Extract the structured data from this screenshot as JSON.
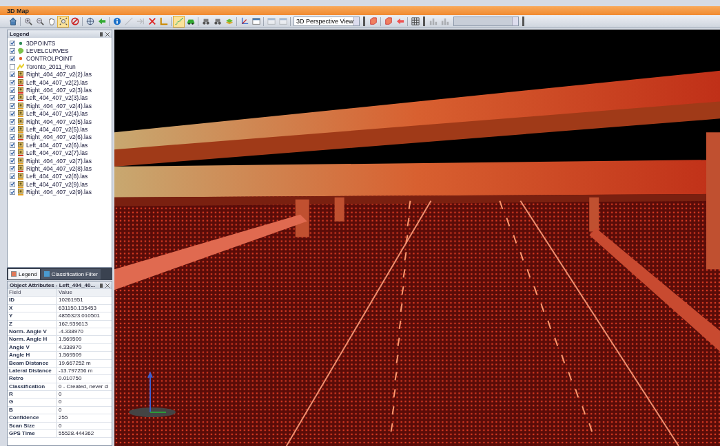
{
  "window": {
    "title": "3D Map"
  },
  "toolbar": {
    "buttons": [
      {
        "active": false,
        "disabled": false
      },
      {
        "active": false,
        "disabled": false
      },
      {
        "active": false,
        "disabled": false
      },
      {
        "active": false,
        "disabled": false
      },
      {
        "active": true,
        "disabled": false
      },
      {
        "active": false,
        "disabled": false
      },
      {
        "active": false,
        "disabled": false
      },
      {
        "active": false,
        "disabled": false
      },
      {
        "active": false,
        "disabled": false
      },
      {
        "active": false,
        "disabled": true
      },
      {
        "active": false,
        "disabled": true
      },
      {
        "active": false,
        "disabled": false
      },
      {
        "active": false,
        "disabled": false
      },
      {
        "active": true,
        "disabled": false
      },
      {
        "active": false,
        "disabled": false
      },
      {
        "active": false,
        "disabled": false
      },
      {
        "active": false,
        "disabled": false
      },
      {
        "active": false,
        "disabled": false
      },
      {
        "active": false,
        "disabled": false
      },
      {
        "active": false,
        "disabled": false
      },
      {
        "active": false,
        "disabled": true
      },
      {
        "active": false,
        "disabled": true
      }
    ],
    "view_select": {
      "value": "3D Perspective View"
    },
    "buttons2": [
      {
        "active": false,
        "disabled": false
      },
      {
        "active": false,
        "disabled": false
      },
      {
        "active": false,
        "disabled": false
      },
      {
        "active": false,
        "disabled": false
      }
    ],
    "buttons3": [
      {
        "active": false,
        "disabled": true
      },
      {
        "active": false,
        "disabled": true
      }
    ],
    "combo": {
      "disabled": true
    }
  },
  "legend": {
    "title": "Legend",
    "items": [
      {
        "label": "3DPOINTS",
        "kind": "point",
        "color": "#2e8b57",
        "checked": true
      },
      {
        "label": "LEVELCURVES",
        "kind": "polygon",
        "color": "#7cc24a",
        "checked": true
      },
      {
        "label": "CONTROLPOINT",
        "kind": "point",
        "color": "#e0602a",
        "checked": true
      },
      {
        "label": "Toronto_2011_Run",
        "kind": "line",
        "color": "#e8d030",
        "checked": false
      },
      {
        "label": "Right_404_407_v2(2).las",
        "kind": "las",
        "color": "#e03020",
        "checked": true
      },
      {
        "label": "Left_404_407_v2(2).las",
        "kind": "las",
        "color": "#e03020",
        "checked": true
      },
      {
        "label": "Right_404_407_v2(3).las",
        "kind": "las",
        "color": "#e03020",
        "checked": true
      },
      {
        "label": "Left_404_407_v2(3).las",
        "kind": "las",
        "color": "#e03020",
        "checked": true
      },
      {
        "label": "Right_404_407_v2(4).las",
        "kind": "las",
        "color": "#e8a020",
        "checked": true
      },
      {
        "label": "Left_404_407_v2(4).las",
        "kind": "las",
        "color": "#e8a020",
        "checked": true
      },
      {
        "label": "Right_404_407_v2(5).las",
        "kind": "las",
        "color": "#e8a020",
        "checked": true
      },
      {
        "label": "Left_404_407_v2(5).las",
        "kind": "las",
        "color": "#e8a020",
        "checked": true
      },
      {
        "label": "Right_404_407_v2(6).las",
        "kind": "las",
        "color": "#e03020",
        "checked": true
      },
      {
        "label": "Left_404_407_v2(6).las",
        "kind": "las",
        "color": "#e8a020",
        "checked": true
      },
      {
        "label": "Left_404_407_v2(7).las",
        "kind": "las",
        "color": "#e03020",
        "checked": true
      },
      {
        "label": "Right_404_407_v2(7).las",
        "kind": "las",
        "color": "#e8a020",
        "checked": true
      },
      {
        "label": "Right_404_407_v2(8).las",
        "kind": "las",
        "color": "#e03020",
        "checked": true
      },
      {
        "label": "Left_404_407_v2(8).las",
        "kind": "las",
        "color": "#e8a020",
        "checked": true
      },
      {
        "label": "Left_404_407_v2(9).las",
        "kind": "las",
        "color": "#e8a020",
        "checked": true
      },
      {
        "label": "Right_404_407_v2(9).las",
        "kind": "las",
        "color": "#e8a020",
        "checked": true
      }
    ]
  },
  "panel_tabs": [
    {
      "label": "Legend",
      "selected": true
    },
    {
      "label": "Classification Filter",
      "selected": false
    }
  ],
  "attributes": {
    "title": "Object Attributes - Left_404_40...",
    "columns": [
      "Field",
      "Value"
    ],
    "rows": [
      [
        "ID",
        "10261951"
      ],
      [
        "X",
        "631150.135453"
      ],
      [
        "Y",
        "4855323.010501"
      ],
      [
        "Z",
        "162.939613"
      ],
      [
        "Norm. Angle V",
        "-4.338970"
      ],
      [
        "Norm. Angle H",
        "1.569509"
      ],
      [
        "Angle V",
        "4.338970"
      ],
      [
        "Angle H",
        "1.569509"
      ],
      [
        "Beam Distance",
        "19.667252 m"
      ],
      [
        "Lateral Distance",
        "-13.797256 m"
      ],
      [
        "Retro",
        "0.010750"
      ],
      [
        "Classification",
        "0 - Created, never cl"
      ],
      [
        "R",
        "0"
      ],
      [
        "G",
        "0"
      ],
      [
        "B",
        "0"
      ],
      [
        "Confidence",
        "255"
      ],
      [
        "Scan Size",
        "0"
      ],
      [
        "GPS Time",
        "55528.444362"
      ]
    ]
  }
}
